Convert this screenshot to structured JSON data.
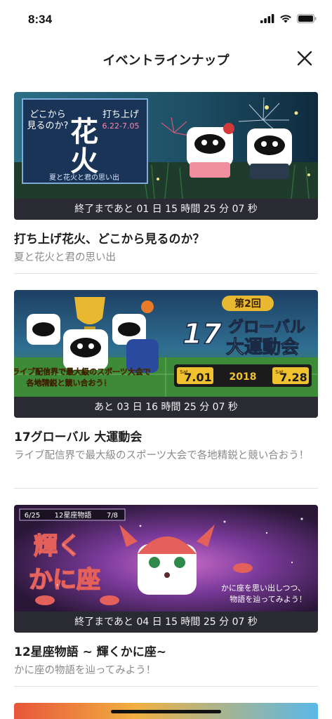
{
  "status_bar": {
    "time": "8:34"
  },
  "header": {
    "title": "イベントラインナップ"
  },
  "events": [
    {
      "countdown": "終了まであと 01 日 15 時間 25 分 07 秒",
      "title": "打ち上げ花火、どこから見るのか？",
      "description": "夏と花火と君の思い出",
      "banner": {
        "headline_line1": "花",
        "headline_line2": "火",
        "sub_left": "どこから",
        "sub_left2": "見るのか?",
        "sub_right": "打ち上げ",
        "dates": "6.22-7.05",
        "tagline": "夏と花火と君の思い出",
        "colors": {
          "sky": "#1d4d63",
          "grass": "#1f3b2b",
          "panel": "#1a3458"
        }
      }
    },
    {
      "countdown": "あと 03 日 16 時間 25 分 07 秒",
      "title": "17グローバル 大運動会",
      "description": "ライブ配信界で最大級のスポーツ大会で各地精鋭と競い合おう！",
      "banner": {
        "badge": "第2回",
        "logo_number": "17",
        "logo_text1": "グローバル",
        "logo_text2": "大運動会",
        "caption_line1": "ライブ配信界で最大級のスポーツ大会で",
        "caption_line2": "各地精鋭と競い合おう！",
        "start_day": "Sat",
        "start_date": "7.01",
        "year": "2018",
        "end_day": "Sat",
        "end_date": "7.28",
        "colors": {
          "sky": "#2f6f92",
          "field": "#3d8a38",
          "gold": "#e8b830"
        }
      }
    },
    {
      "countdown": "終了まであと 04 日 15 時間 25 分 07 秒",
      "title": "12星座物語 ~ 輝くかに座~",
      "description": "かに座の物語を辿ってみよう！",
      "banner": {
        "ribbon_left": "6/25",
        "ribbon_mid": "12星座物語",
        "ribbon_right": "7/8",
        "headline1": "輝く",
        "headline2": "かに座",
        "caption_line1": "かに座を思い出しつつ、",
        "caption_line2": "物語を辿ってみよう！",
        "colors": {
          "space": "#2a1738",
          "nebula": "#7a3a9a",
          "crab": "#e4605a"
        }
      }
    }
  ]
}
